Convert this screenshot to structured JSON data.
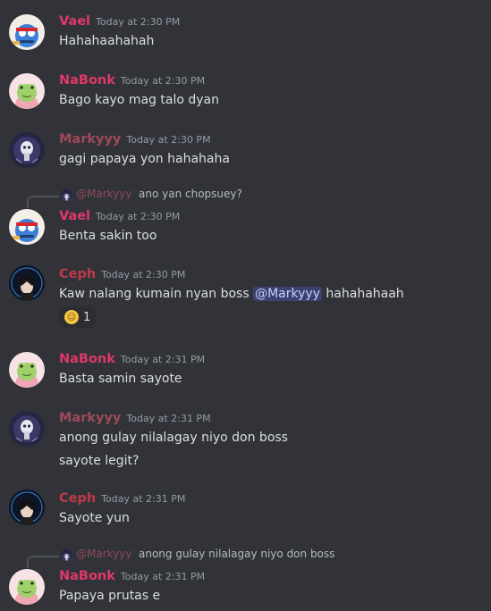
{
  "colors": {
    "background": "#313338",
    "vael": "#e0386b",
    "nabonk": "#e0386b",
    "markyyy": "#a04a5a",
    "ceph": "#c0394b",
    "timestamp": "#949ba4",
    "mention_bg": "#3c4270"
  },
  "messages": [
    {
      "author": "Vael",
      "time": "Today at 2:30 PM",
      "lines": [
        "Hahahaahahah"
      ],
      "avatar": "vael-avatar"
    },
    {
      "author": "NaBonk",
      "time": "Today at 2:30 PM",
      "lines": [
        "Bago kayo mag talo dyan"
      ],
      "avatar": "nabonk-avatar"
    },
    {
      "author": "Markyyy",
      "time": "Today at 2:30 PM",
      "lines": [
        "gagi papaya yon hahahaha"
      ],
      "avatar": "markyyy-avatar"
    },
    {
      "reply": {
        "author": "@Markyyy",
        "text": "ano yan chopsuey?"
      },
      "author": "Vael",
      "time": "Today at 2:30 PM",
      "lines": [
        "Benta sakin too"
      ],
      "avatar": "vael-avatar"
    },
    {
      "author": "Ceph",
      "time": "Today at 2:30 PM",
      "line_before": "Kaw nalang kumain nyan boss",
      "mention": "@Markyyy",
      "line_after": "hahahahaah",
      "reaction": {
        "emoji": "rolling-on-floor-laughing-emoji",
        "count": "1"
      },
      "avatar": "ceph-avatar"
    },
    {
      "author": "NaBonk",
      "time": "Today at 2:31 PM",
      "lines": [
        "Basta samin sayote"
      ],
      "avatar": "nabonk-avatar"
    },
    {
      "author": "Markyyy",
      "time": "Today at 2:31 PM",
      "lines": [
        "anong gulay nilalagay niyo don boss",
        "sayote legit?"
      ],
      "avatar": "markyyy-avatar"
    },
    {
      "author": "Ceph",
      "time": "Today at 2:31 PM",
      "lines": [
        "Sayote yun"
      ],
      "avatar": "ceph-avatar"
    },
    {
      "reply": {
        "author": "@Markyyy",
        "text": "anong gulay nilalagay niyo don boss"
      },
      "author": "NaBonk",
      "time": "Today at 2:31 PM",
      "lines": [
        "Papaya prutas e"
      ],
      "avatar": "nabonk-avatar"
    }
  ]
}
